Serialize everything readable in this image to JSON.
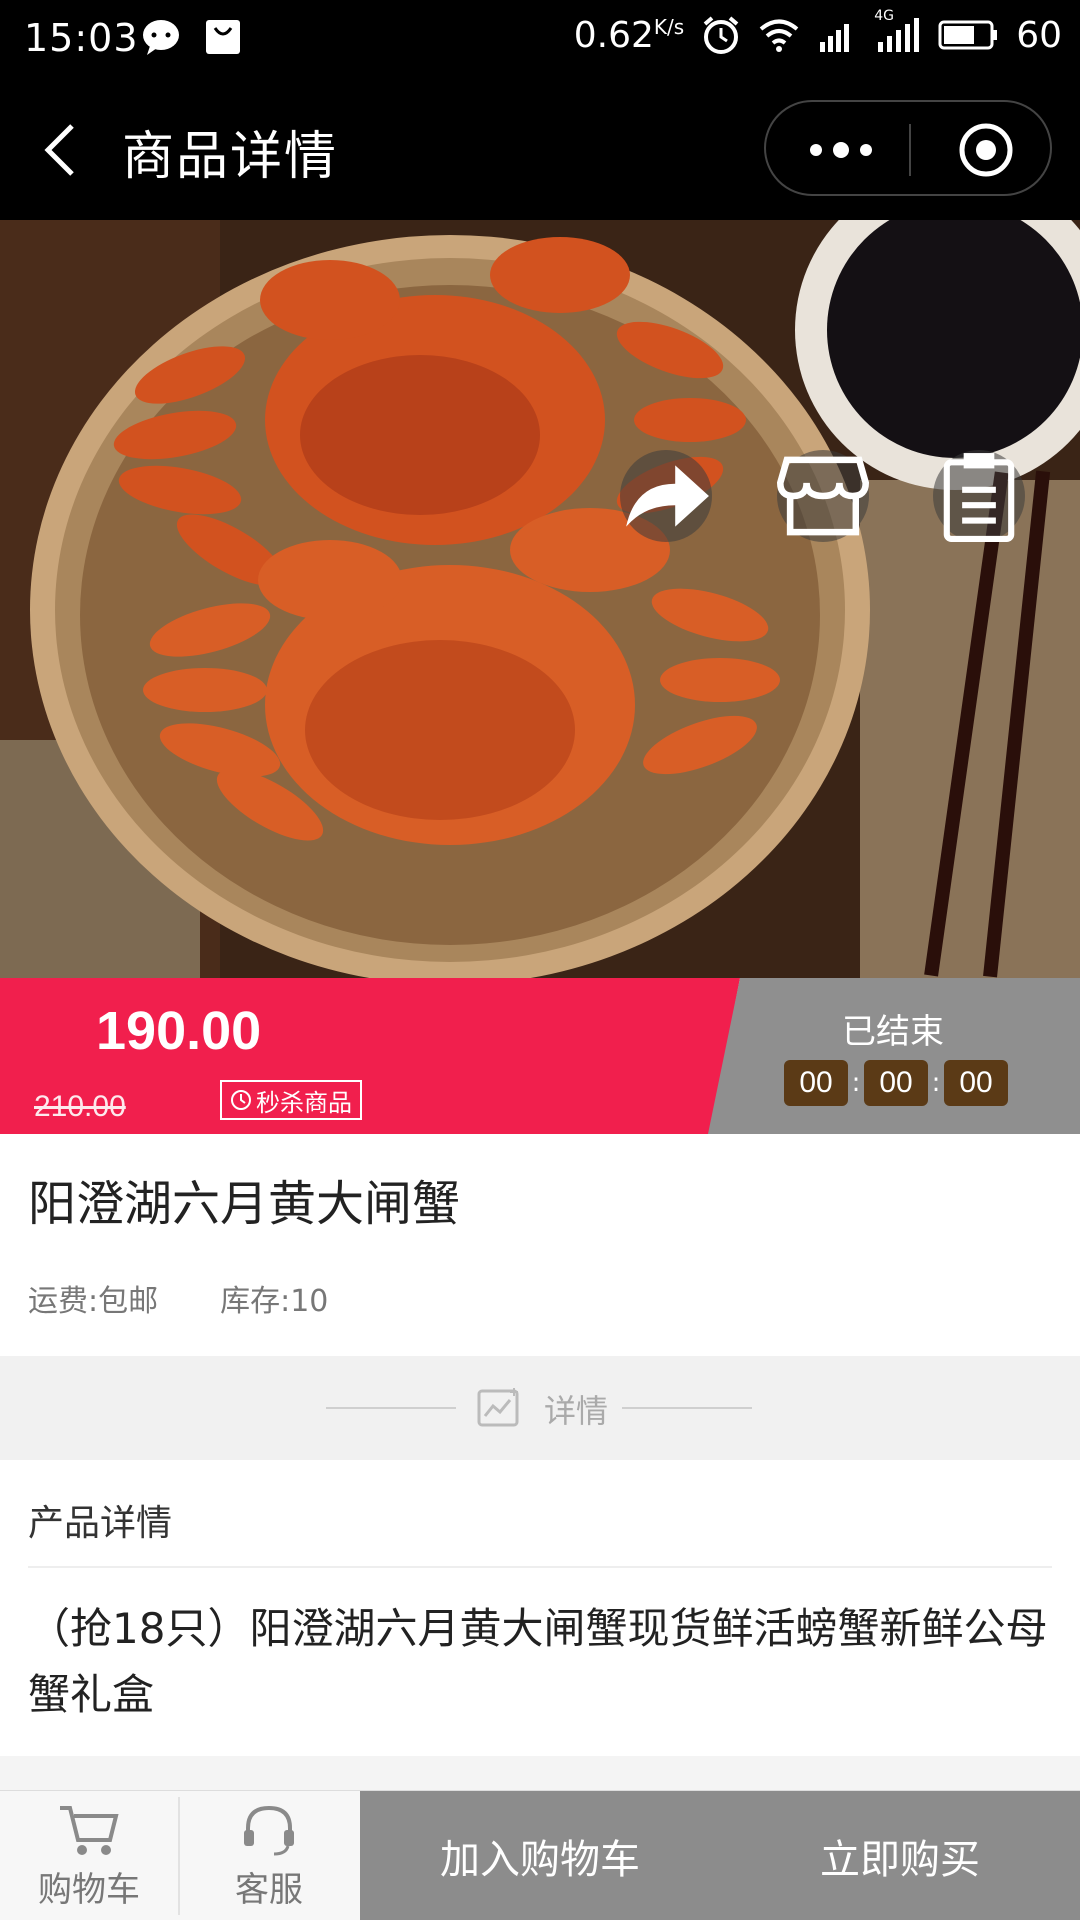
{
  "status_bar": {
    "time": "15:03",
    "left_icons": [
      "chat-bubble-icon",
      "shopping-bag-icon"
    ],
    "net_speed": "0.62",
    "net_speed_unit": "K/s",
    "network_label": "4G",
    "battery_level": "60"
  },
  "nav": {
    "title": "商品详情",
    "back_icon": "chevron-left-icon",
    "more_icon": "more-dots-icon",
    "close_icon": "target-circle-icon"
  },
  "hero": {
    "actions": [
      "share-arrow-icon",
      "store-icon",
      "clipboard-list-icon"
    ]
  },
  "price": {
    "current": "190.00",
    "original": "210.00",
    "badge": "秒杀商品",
    "status": "已结束",
    "countdown": [
      "00",
      "00",
      "00"
    ],
    "colors": {
      "accent": "#f11f4d",
      "ended": "#8f8f8f",
      "countdown_box": "#5b3a16"
    }
  },
  "product": {
    "title": "阳澄湖六月黄大闸蟹",
    "shipping": "运费:包邮",
    "stock": "库存:10"
  },
  "detail_divider": {
    "label": "详情"
  },
  "product_detail": {
    "heading": "产品详情",
    "description": "（抢18只）阳澄湖六月黄大闸蟹现货鲜活螃蟹新鲜公母蟹礼盒"
  },
  "bottom_bar": {
    "cart": "购物车",
    "service": "客服",
    "add_to_cart": "加入购物车",
    "buy_now": "立即购买"
  }
}
